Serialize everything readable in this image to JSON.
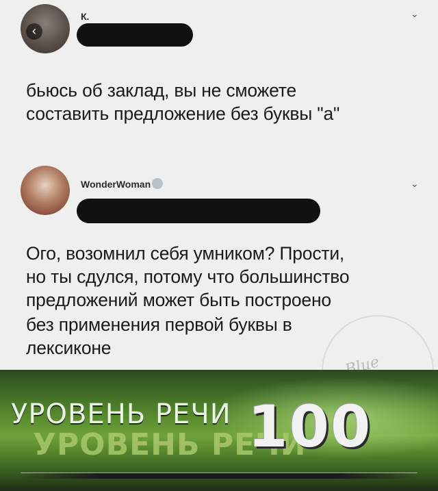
{
  "post1": {
    "username": "К.",
    "text_line1": "бьюсь об заклад, вы не сможете",
    "text_line2": "составить предложение без буквы \"а\"",
    "back_icon": "‹",
    "chevron_icon": "⌄"
  },
  "post2": {
    "username": "WonderWoman",
    "text_line1": "Ого, возомнил себя умником? Прости,",
    "text_line2": "но ты сдулся, потому что большинство",
    "text_line3": "предложений может быть построено",
    "text_line4": "без применения первой буквы в",
    "text_line5": "лексиконе",
    "chevron_icon": "⌄"
  },
  "watermark": {
    "text": "Blue Smoke"
  },
  "meme": {
    "caption": "УРОВЕНЬ РЕЧИ",
    "level": "100"
  }
}
